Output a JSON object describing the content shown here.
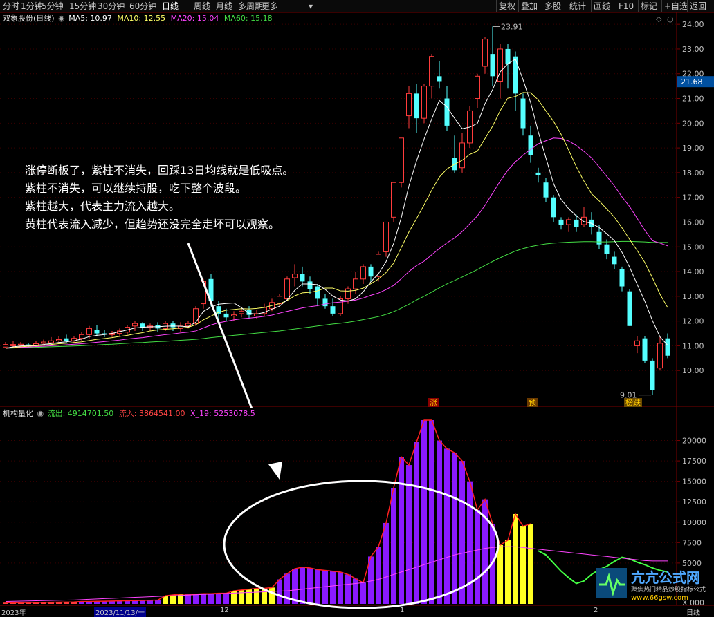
{
  "toolbar": {
    "periods": [
      "分时",
      "1分钟",
      "5分钟",
      "15分钟",
      "30分钟",
      "60分钟",
      "日线",
      "周线",
      "月线",
      "多周期",
      "更多"
    ],
    "active_period": "日线",
    "right_buttons": [
      "复权",
      "叠加",
      "多股",
      "统计",
      "画线",
      "F10",
      "标记",
      "+自选",
      "返回"
    ]
  },
  "price_header": {
    "stock": "双象股份(日线)",
    "ma5": "MA5: 10.97",
    "ma10": "MA10: 12.55",
    "ma20": "MA20: 15.04",
    "ma60": "MA60: 15.18"
  },
  "price_axis": {
    "labels": [
      "24.00",
      "23.00",
      "22.00",
      "21.00",
      "20.00",
      "19.00",
      "18.00",
      "17.00",
      "16.00",
      "15.00",
      "14.00",
      "13.00",
      "12.00",
      "11.00",
      "10.00"
    ],
    "current_price": "21.68",
    "high_label": "23.91",
    "low_label": "9.01"
  },
  "annotation": {
    "lines": [
      "涨停断板了，紫柱不消失，回踩13日均线就是低吸点。",
      "紫柱不消失，可以继续持股，吃下整个波段。",
      "紫柱越大，代表主力流入越大。",
      "黄柱代表流入减少，但趋势还没完全走坏可以观察。"
    ]
  },
  "markers": {
    "zhang": "涨",
    "yu": "预",
    "bang": "榜跌"
  },
  "indicator_header": {
    "name": "机构量化",
    "outflow": "流出: 4914701.50",
    "inflow": "流入: 3864541.00",
    "x19": "X_19: 5253078.5"
  },
  "indicator_axis": {
    "labels": [
      "20000",
      "17500",
      "15000",
      "12500",
      "10000",
      "7500",
      "5000"
    ],
    "partial_label": "X 000"
  },
  "date_axis": {
    "labels": [
      "2023年",
      "2023/11/13/一",
      "12",
      "1",
      "2"
    ],
    "right_label": "日线"
  },
  "watermark": {
    "title": "亢亢公式网",
    "subtitle": "聚焦热门精品炒股指标公式",
    "url": "www.66gsw.com"
  },
  "colors": {
    "up": "#ff3c3c",
    "down": "#54ffff",
    "ma5": "#ffffff",
    "ma10": "#ffff66",
    "ma20": "#ff44ff",
    "ma60": "#44dd44",
    "purple_bar": "#8a1aff",
    "yellow_bar": "#ffff22",
    "grid": "#3a0000"
  },
  "chart_data": {
    "type": "candlestick",
    "title": "双象股份(日线)",
    "y_range": [
      9.0,
      24.2
    ],
    "price_high": 23.91,
    "price_low": 9.01,
    "last_price": 21.68,
    "candles": [
      [
        10.95,
        11.05,
        11.15,
        10.9
      ],
      [
        11.0,
        11.05,
        11.2,
        10.95
      ],
      [
        11.02,
        11.06,
        11.15,
        10.98
      ],
      [
        11.05,
        10.98,
        11.1,
        10.92
      ],
      [
        11.0,
        11.08,
        11.2,
        10.95
      ],
      [
        11.1,
        11.15,
        11.25,
        11.0
      ],
      [
        11.12,
        11.2,
        11.35,
        11.05
      ],
      [
        11.2,
        11.25,
        11.4,
        11.1
      ],
      [
        11.3,
        11.2,
        11.45,
        11.1
      ],
      [
        11.2,
        11.3,
        11.4,
        11.1
      ],
      [
        11.3,
        11.45,
        11.55,
        11.2
      ],
      [
        11.45,
        11.7,
        11.8,
        11.3
      ],
      [
        11.65,
        11.5,
        11.85,
        11.4
      ],
      [
        11.5,
        11.45,
        11.65,
        11.35
      ],
      [
        11.45,
        11.5,
        11.6,
        11.35
      ],
      [
        11.5,
        11.6,
        11.7,
        11.4
      ],
      [
        11.55,
        11.75,
        11.85,
        11.45
      ],
      [
        11.8,
        11.9,
        12.0,
        11.6
      ],
      [
        11.9,
        11.75,
        11.95,
        11.6
      ],
      [
        11.75,
        11.8,
        11.9,
        11.6
      ],
      [
        11.85,
        11.7,
        11.95,
        11.55
      ],
      [
        11.7,
        11.9,
        12.0,
        11.6
      ],
      [
        11.9,
        11.75,
        12.0,
        11.6
      ],
      [
        11.7,
        11.8,
        11.95,
        11.55
      ],
      [
        11.8,
        11.9,
        12.0,
        11.7
      ],
      [
        11.9,
        12.5,
        12.6,
        11.8
      ],
      [
        12.7,
        13.6,
        13.7,
        12.5
      ],
      [
        13.7,
        12.8,
        13.9,
        12.6
      ],
      [
        12.6,
        12.3,
        12.8,
        12.1
      ],
      [
        12.3,
        12.15,
        12.5,
        12.0
      ],
      [
        12.2,
        12.25,
        12.4,
        12.0
      ],
      [
        12.3,
        12.4,
        12.55,
        12.15
      ],
      [
        12.45,
        12.25,
        12.6,
        12.1
      ],
      [
        12.2,
        12.3,
        12.45,
        12.1
      ],
      [
        12.3,
        12.55,
        12.7,
        12.2
      ],
      [
        12.5,
        12.75,
        12.9,
        12.4
      ],
      [
        12.7,
        13.0,
        13.1,
        12.6
      ],
      [
        12.9,
        13.7,
        13.8,
        12.8
      ],
      [
        13.75,
        13.9,
        14.3,
        13.4
      ],
      [
        13.9,
        13.6,
        14.2,
        13.4
      ],
      [
        13.6,
        13.3,
        13.8,
        13.1
      ],
      [
        13.4,
        12.9,
        13.5,
        12.6
      ],
      [
        12.9,
        12.6,
        13.1,
        12.5
      ],
      [
        12.6,
        12.3,
        12.9,
        12.2
      ],
      [
        12.3,
        12.9,
        13.0,
        12.2
      ],
      [
        12.9,
        13.3,
        13.4,
        12.7
      ],
      [
        13.3,
        13.7,
        14.0,
        13.1
      ],
      [
        13.7,
        14.2,
        14.3,
        13.5
      ],
      [
        14.2,
        13.8,
        14.3,
        13.6
      ],
      [
        13.8,
        14.7,
        14.8,
        13.6
      ],
      [
        14.8,
        16.0,
        16.0,
        14.6
      ],
      [
        16.2,
        17.6,
        17.6,
        16.0
      ],
      [
        17.6,
        19.4,
        19.4,
        17.4
      ],
      [
        20.3,
        21.2,
        21.5,
        19.8
      ],
      [
        21.2,
        20.2,
        21.6,
        19.6
      ],
      [
        20.2,
        21.5,
        21.6,
        20.0
      ],
      [
        21.5,
        22.7,
        22.8,
        21.0
      ],
      [
        21.9,
        21.7,
        22.5,
        21.4
      ],
      [
        21.0,
        19.9,
        21.5,
        19.7
      ],
      [
        18.6,
        18.1,
        19.5,
        18.0
      ],
      [
        18.2,
        19.2,
        19.6,
        18.0
      ],
      [
        19.2,
        20.5,
        20.7,
        19.0
      ],
      [
        21.0,
        21.9,
        22.0,
        20.6
      ],
      [
        22.3,
        23.4,
        23.5,
        22.0
      ],
      [
        22.8,
        21.9,
        23.91,
        21.5
      ],
      [
        21.7,
        23.0,
        23.2,
        21.0
      ],
      [
        23.0,
        22.4,
        23.2,
        21.4
      ],
      [
        22.7,
        21.2,
        22.9,
        20.5
      ],
      [
        21.0,
        19.8,
        21.2,
        19.5
      ],
      [
        19.5,
        18.7,
        19.9,
        18.4
      ],
      [
        18.0,
        17.9,
        18.2,
        17.6
      ],
      [
        17.6,
        17.0,
        17.8,
        16.8
      ],
      [
        17.0,
        16.2,
        17.1,
        16.0
      ],
      [
        16.1,
        15.9,
        16.2,
        15.7
      ],
      [
        15.9,
        16.1,
        16.2,
        15.6
      ],
      [
        16.1,
        15.8,
        16.3,
        15.6
      ],
      [
        15.9,
        16.2,
        16.6,
        15.8
      ],
      [
        16.1,
        15.8,
        16.4,
        15.5
      ],
      [
        15.6,
        15.1,
        15.9,
        14.9
      ],
      [
        15.1,
        14.7,
        15.3,
        14.5
      ],
      [
        14.6,
        14.3,
        14.8,
        14.1
      ],
      [
        14.1,
        13.4,
        14.2,
        13.2
      ],
      [
        13.2,
        11.8,
        13.3,
        11.8
      ],
      [
        11.0,
        11.2,
        11.4,
        10.7
      ],
      [
        11.3,
        10.4,
        11.4,
        10.3
      ],
      [
        10.4,
        9.2,
        10.5,
        9.01
      ],
      [
        10.1,
        11.1,
        11.4,
        10.0
      ],
      [
        11.3,
        10.6,
        11.5,
        10.5
      ]
    ],
    "ma5": [
      10.9,
      10.96,
      10.99,
      11.01,
      11.02,
      11.05,
      11.09,
      11.13,
      11.16,
      11.2,
      11.27,
      11.37,
      11.42,
      11.45,
      11.5,
      11.57,
      11.64,
      11.72,
      11.75,
      11.77,
      11.77,
      11.79,
      11.8,
      11.79,
      11.77,
      11.95,
      12.39,
      12.57,
      12.68,
      12.71,
      12.73,
      12.54,
      12.31,
      12.28,
      12.35,
      12.48,
      12.6,
      12.86,
      13.24,
      13.5,
      13.5,
      13.47,
      13.28,
      13.01,
      12.85,
      12.81,
      12.9,
      13.18,
      13.59,
      13.91,
      14.4,
      15.14,
      16.18,
      17.46,
      18.47,
      19.36,
      20.17,
      20.92,
      20.66,
      20.2,
      19.78,
      19.84,
      19.99,
      20.79,
      21.36,
      22.08,
      22.4,
      22.59,
      21.76,
      20.83,
      19.65,
      18.6,
      17.56,
      16.92,
      16.54,
      16.25,
      16.02,
      15.95,
      15.78,
      15.53,
      15.25,
      14.78,
      14.18,
      13.48,
      12.8,
      12.02,
      11.36,
      11.02
    ],
    "ma10": [
      10.9,
      10.93,
      10.96,
      10.98,
      11.0,
      11.02,
      11.05,
      11.08,
      11.1,
      11.13,
      11.16,
      11.21,
      11.26,
      11.29,
      11.33,
      11.38,
      11.42,
      11.48,
      11.53,
      11.6,
      11.64,
      11.67,
      11.69,
      11.72,
      11.75,
      11.85,
      12.05,
      12.2,
      12.35,
      12.44,
      12.47,
      12.5,
      12.49,
      12.51,
      12.55,
      12.63,
      12.7,
      12.83,
      13.02,
      13.14,
      13.16,
      13.22,
      13.33,
      13.33,
      13.22,
      13.21,
      13.24,
      13.33,
      13.51,
      13.7,
      13.96,
      14.34,
      14.97,
      15.6,
      16.14,
      16.7,
      17.29,
      17.82,
      18.15,
      18.34,
      18.5,
      18.74,
      18.87,
      19.38,
      19.88,
      20.51,
      21.01,
      21.08,
      21.24,
      21.23,
      20.94,
      20.5,
      20.08,
      19.55,
      18.91,
      18.24,
      17.66,
      17.15,
      16.86,
      16.53,
      16.2,
      15.77,
      15.3,
      14.85,
      14.37,
      13.75,
      13.08,
      12.55
    ],
    "ma20": [
      10.9,
      10.92,
      10.94,
      10.95,
      10.97,
      10.98,
      11.0,
      11.02,
      11.04,
      11.06,
      11.08,
      11.11,
      11.14,
      11.17,
      11.2,
      11.23,
      11.27,
      11.3,
      11.33,
      11.37,
      11.41,
      11.45,
      11.48,
      11.52,
      11.55,
      11.6,
      11.72,
      11.84,
      11.93,
      11.99,
      12.05,
      12.09,
      12.12,
      12.15,
      12.19,
      12.24,
      12.32,
      12.39,
      12.46,
      12.53,
      12.58,
      12.62,
      12.69,
      12.74,
      12.77,
      12.8,
      12.85,
      12.93,
      13.04,
      13.13,
      13.27,
      13.44,
      13.71,
      14.0,
      14.24,
      14.42,
      14.68,
      14.93,
      15.16,
      15.36,
      15.62,
      15.93,
      16.25,
      16.68,
      17.17,
      17.66,
      18.1,
      18.44,
      18.71,
      18.94,
      19.17,
      19.29,
      19.4,
      19.38,
      19.28,
      19.1,
      18.86,
      18.6,
      18.23,
      17.85,
      17.47,
      17.02,
      16.63,
      16.15,
      15.67,
      15.25,
      15.15,
      15.04
    ],
    "ma60": [
      10.9,
      10.91,
      10.92,
      10.93,
      10.94,
      10.95,
      10.96,
      10.97,
      10.98,
      10.99,
      11.0,
      11.02,
      11.03,
      11.05,
      11.06,
      11.08,
      11.1,
      11.12,
      11.13,
      11.15,
      11.17,
      11.18,
      11.2,
      11.22,
      11.24,
      11.26,
      11.29,
      11.33,
      11.36,
      11.39,
      11.42,
      11.45,
      11.48,
      11.51,
      11.54,
      11.57,
      11.6,
      11.64,
      11.68,
      11.72,
      11.76,
      11.8,
      11.84,
      11.88,
      11.91,
      11.95,
      12.0,
      12.06,
      12.12,
      12.18,
      12.27,
      12.38,
      12.52,
      12.68,
      12.85,
      13.0,
      13.17,
      13.34,
      13.5,
      13.64,
      13.78,
      13.93,
      14.08,
      14.25,
      14.41,
      14.56,
      14.7,
      14.83,
      14.93,
      15.01,
      15.07,
      15.12,
      15.15,
      15.17,
      15.19,
      15.2,
      15.21,
      15.21,
      15.2,
      15.2,
      15.21,
      15.22,
      15.22,
      15.21,
      15.2,
      15.18,
      15.18,
      15.18
    ]
  },
  "indicator_data": {
    "type": "bar",
    "y_range": [
      0,
      22500
    ],
    "bars": [
      {
        "from": 0,
        "to": 9,
        "color": "#ff3c3c",
        "values": [
          150,
          150,
          160,
          170,
          180,
          190,
          200,
          210,
          220,
          230
        ]
      },
      {
        "from": 10,
        "to": 20,
        "color": "#8a1aff",
        "values": [
          300,
          300,
          320,
          330,
          350,
          370,
          380,
          400,
          420,
          440,
          460
        ]
      },
      {
        "from": 21,
        "to": 23,
        "color": "#ffff22",
        "values": [
          1000,
          1100,
          1200
        ]
      },
      {
        "from": 24,
        "to": 29,
        "color": "#8a1aff",
        "values": [
          1200,
          1200,
          1250,
          1250,
          1300,
          1300
        ]
      },
      {
        "from": 30,
        "to": 35,
        "color": "#ffff22",
        "values": [
          1600,
          1700,
          1800,
          1900,
          1900,
          2000
        ]
      },
      {
        "from": 36,
        "to": 47,
        "color": "#8a1aff",
        "values": [
          3000,
          3700,
          4300,
          4500,
          4400,
          4200,
          4100,
          4000,
          3900,
          3600,
          3100,
          2600
        ]
      },
      {
        "from": 48,
        "to": 64,
        "color": "#8a1aff",
        "values": [
          5800,
          7000,
          9900,
          14200,
          18000,
          17000,
          19800,
          22500,
          22500,
          20000,
          19000,
          18500,
          17500,
          15000,
          11500,
          12800,
          9800
        ]
      },
      {
        "from": 65,
        "to": 69,
        "color": "#ffff22",
        "values": [
          7200,
          7800,
          11000,
          9500,
          9800
        ]
      },
      {
        "from": 70,
        "to": 87,
        "color": "#54ff54",
        "values": [
          6500,
          6000,
          5000,
          4000,
          3200,
          2500,
          2800,
          3600,
          4200,
          4600,
          5200,
          5700,
          5500,
          5100,
          4800,
          4400,
          4100,
          3900
        ]
      }
    ],
    "x19_line": [
      300,
      320,
      340,
      360,
      380,
      400,
      420,
      440,
      460,
      480,
      520,
      560,
      600,
      640,
      680,
      720,
      760,
      800,
      840,
      880,
      920,
      960,
      1000,
      1040,
      1080,
      1120,
      1160,
      1200,
      1240,
      1280,
      1320,
      1360,
      1400,
      1440,
      1480,
      1520,
      1560,
      1600,
      1700,
      1800,
      1900,
      2000,
      2100,
      2200,
      2300,
      2400,
      2500,
      2600,
      2800,
      3000,
      3300,
      3600,
      3900,
      4200,
      4500,
      4800,
      5100,
      5400,
      5700,
      6000,
      6200,
      6400,
      6600,
      6800,
      6900,
      7000,
      7000,
      7000,
      6900,
      6800,
      6700,
      6600,
      6500,
      6400,
      6300,
      6200,
      6100,
      6000,
      5900,
      5800,
      5700,
      5600,
      5500,
      5400,
      5300,
      5250,
      5253,
      5253
    ]
  }
}
